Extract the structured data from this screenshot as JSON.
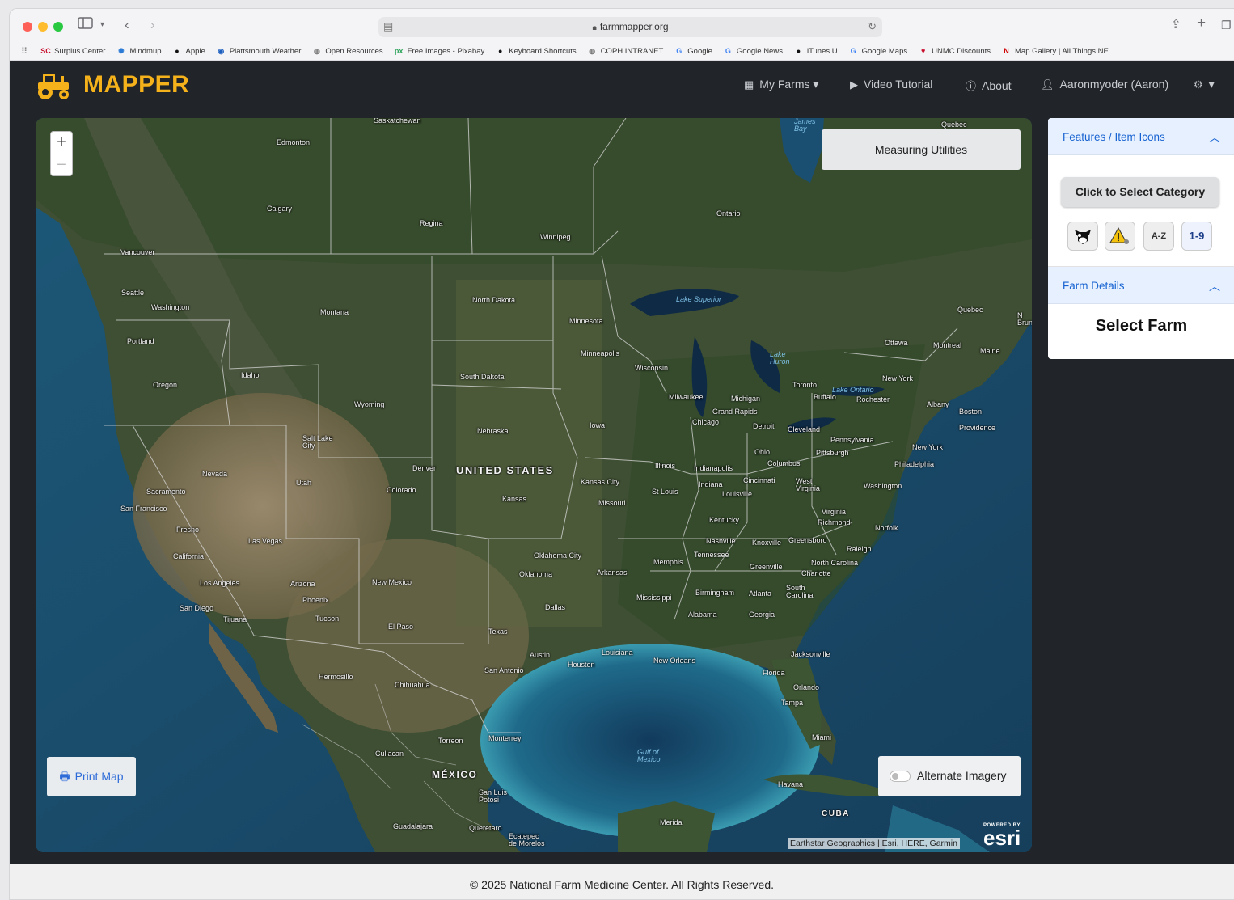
{
  "browser": {
    "url": "farmmapper.org",
    "bookmarks": [
      {
        "label": "Surplus Center",
        "icon": "SC",
        "color": "#c8102e"
      },
      {
        "label": "Mindmup",
        "icon": "✺",
        "color": "#2b7bd6"
      },
      {
        "label": "Apple",
        "icon": "●",
        "color": "#111111"
      },
      {
        "label": "Plattsmouth Weather",
        "icon": "◉",
        "color": "#1d5fbf"
      },
      {
        "label": "Open Resources",
        "icon": "◍",
        "color": "#777777"
      },
      {
        "label": "Free Images - Pixabay",
        "icon": "px",
        "color": "#2ca35a"
      },
      {
        "label": "Keyboard Shortcuts",
        "icon": "●",
        "color": "#111111"
      },
      {
        "label": "COPH INTRANET",
        "icon": "◍",
        "color": "#777777"
      },
      {
        "label": "Google",
        "icon": "G",
        "color": "#4285f4"
      },
      {
        "label": "Google News",
        "icon": "G",
        "color": "#4285f4"
      },
      {
        "label": "iTunes U",
        "icon": "●",
        "color": "#111111"
      },
      {
        "label": "Google Maps",
        "icon": "G",
        "color": "#4285f4"
      },
      {
        "label": "UNMC Discounts",
        "icon": "♥",
        "color": "#c8102e"
      },
      {
        "label": "Map Gallery | All Things NE",
        "icon": "N",
        "color": "#d00000"
      }
    ]
  },
  "app": {
    "brand": "MAPPER",
    "brand_color": "#f6b21b",
    "nav": {
      "my_farms": "My Farms ▾",
      "video": "Video Tutorial",
      "about": "About",
      "user": "Aaronmyoder (Aaron)",
      "settings": "▾"
    }
  },
  "map": {
    "measure_label": "Measuring Utilities",
    "print_label": "Print Map",
    "alt_imagery_label": "Alternate Imagery",
    "alt_imagery_on": false,
    "attribution": "Earthstar Geographics | Esri, HERE, Garmin",
    "esri_powered": "POWERED BY",
    "esri_logo": "esri",
    "labels": {
      "saskatchewan": "Saskatchewan",
      "edmonton": "Edmonton",
      "calgary": "Calgary",
      "regina": "Regina",
      "winnipeg": "Winnipeg",
      "vancouver": "Vancouver",
      "seattle": "Seattle",
      "washington_state": "Washington",
      "portland": "Portland",
      "oregon": "Oregon",
      "idaho": "Idaho",
      "montana": "Montana",
      "wyoming": "Wyoming",
      "north_dakota": "North Dakota",
      "south_dakota": "South Dakota",
      "nebraska": "Nebraska",
      "minnesota": "Minnesota",
      "minneapolis": "Minneapolis",
      "wisconsin": "Wisconsin",
      "iowa": "Iowa",
      "nevada": "Nevada",
      "utah": "Utah",
      "salt_lake": "Salt Lake\nCity",
      "colorado": "Colorado",
      "denver": "Denver",
      "united_states": "UNITED STATES",
      "kansas": "Kansas",
      "kansas_city": "Kansas City",
      "missouri": "Missouri",
      "st_louis": "St Louis",
      "illinois": "Illinois",
      "chicago": "Chicago",
      "milwaukee": "Milwaukee",
      "michigan": "Michigan",
      "grand_rapids": "Grand Rapids",
      "detroit": "Detroit",
      "indianapolis": "Indianapolis",
      "indiana": "Indiana",
      "ohio": "Ohio",
      "columbus": "Columbus",
      "cincinnati": "Cincinnati",
      "louisville": "Louisville",
      "kentucky": "Kentucky",
      "cleveland": "Cleveland",
      "pennsylvania": "Pennsylvania",
      "pittsburgh": "Pittsburgh",
      "new_york_state": "New York",
      "new_york_city": "New York",
      "philadelphia": "Philadelphia",
      "washington_dc": "Washington",
      "west_virginia": "West\nVirginia",
      "virginia": "Virginia",
      "richmond": "Richmond",
      "norfolk": "Norfolk",
      "boston": "Boston",
      "providence": "Providence",
      "albany": "Albany",
      "maine": "Maine",
      "quebec": "Quebec",
      "quebec_top": "Quebec",
      "montreal": "Montreal",
      "ottawa": "Ottawa",
      "toronto": "Toronto",
      "buffalo": "Buffalo",
      "rochester": "Rochester",
      "ontario": "Ontario",
      "lake_superior": "Lake Superior",
      "lake_huron": "Lake\nHuron",
      "lake_ontario": "Lake Ontario",
      "james_bay": "James\nBay",
      "sacramento": "Sacramento",
      "san_francisco": "San Francisco",
      "fresno": "Fresno",
      "las_vegas": "Las Vegas",
      "california": "California",
      "los_angeles": "Los Angeles",
      "san_diego": "San Diego",
      "tijuana": "Tijuana",
      "arizona": "Arizona",
      "phoenix": "Phoenix",
      "tucson": "Tucson",
      "new_mexico": "New Mexico",
      "el_paso": "El Paso",
      "oklahoma_city": "Oklahoma City",
      "oklahoma": "Oklahoma",
      "arkansas": "Arkansas",
      "dallas": "Dallas",
      "texas": "Texas",
      "austin": "Austin",
      "san_antonio": "San Antonio",
      "houston": "Houston",
      "louisiana": "Louisiana",
      "new_orleans": "New Orleans",
      "mississippi": "Mississippi",
      "memphis": "Memphis",
      "nashville": "Nashville",
      "tennessee": "Tennessee",
      "knoxville": "Knoxville",
      "greensboro": "Greensboro",
      "raleigh": "Raleigh",
      "north_carolina": "North Carolina",
      "charlotte": "Charlotte",
      "greenville": "Greenville",
      "south_carolina": "South\nCarolina",
      "birmingham": "Birmingham",
      "atlanta": "Atlanta",
      "alabama": "Alabama",
      "georgia": "Georgia",
      "jacksonville": "Jacksonville",
      "florida": "Florida",
      "orlando": "Orlando",
      "tampa": "Tampa",
      "miami": "Miami",
      "havana": "Havana",
      "cuba": "CUBA",
      "merida": "Merida",
      "gulf_of_mexico": "Gulf of\nMexico",
      "hermosillo": "Hermosillo",
      "chihuahua": "Chihuahua",
      "torreon": "Torreon",
      "monterrey": "Monterrey",
      "culiacan": "Culiacan",
      "mexico": "MÉXICO",
      "san_luis_potosi": "San Luis\nPotosi",
      "guadalajara": "Guadalajara",
      "queretaro": "Queretaro",
      "ecatepec": "Ecatepec\nde Morelos",
      "brun": "N\nBrun"
    }
  },
  "sidebar": {
    "features_title": "Features / Item Icons",
    "category_button": "Click to Select Category",
    "icon_buttons": {
      "az": "A-Z",
      "num": "1-9"
    },
    "farm_details_title": "Farm Details",
    "select_farm": "Select Farm"
  },
  "footer": {
    "text": "© 2025 National Farm Medicine Center. All Rights Reserved."
  }
}
